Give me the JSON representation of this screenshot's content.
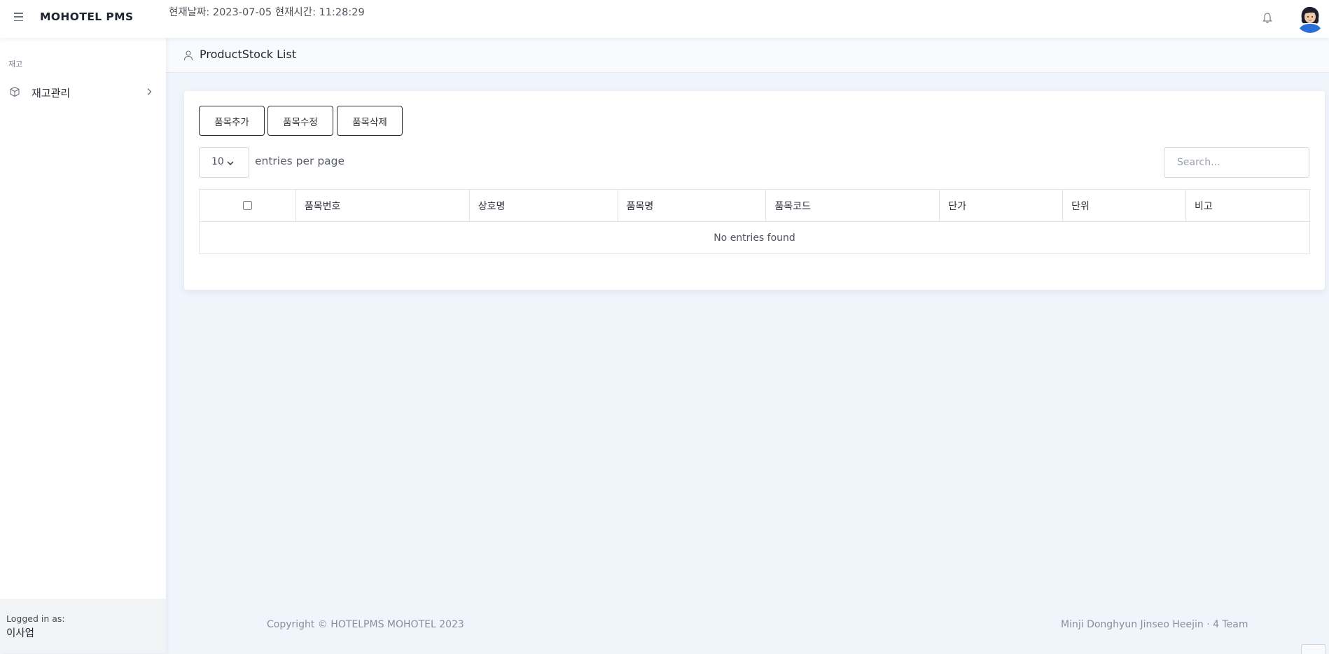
{
  "header": {
    "brand": "MOHOTEL PMS",
    "clock": "현재날짜: 2023-07-05 현재시간: 11:28:29",
    "menu_icon": "hamburger-icon",
    "notification_icon": "bell-icon"
  },
  "sidebar": {
    "heading": "재고",
    "items": [
      {
        "label": "재고관리",
        "icon": "box-icon"
      }
    ],
    "footer": {
      "logged_label": "Logged in as:",
      "user": "이사업"
    }
  },
  "page": {
    "title": "ProductStock List",
    "title_icon": "person-icon"
  },
  "toolbar": {
    "add_label": "품목추가",
    "edit_label": "품목수정",
    "delete_label": "품목삭제"
  },
  "table_controls": {
    "per_page_value": "10",
    "per_page_label": "entries per page",
    "search_placeholder": "Search..."
  },
  "table": {
    "columns": [
      "품목번호",
      "상호명",
      "품목명",
      "품목코드",
      "단가",
      "단위",
      "비고"
    ],
    "empty_message": "No entries found"
  },
  "footer": {
    "copyright": "Copyright © HOTELPMS MOHOTEL 2023",
    "team": "Minji Donghyun Jinseo Heejin · 4 Team"
  }
}
